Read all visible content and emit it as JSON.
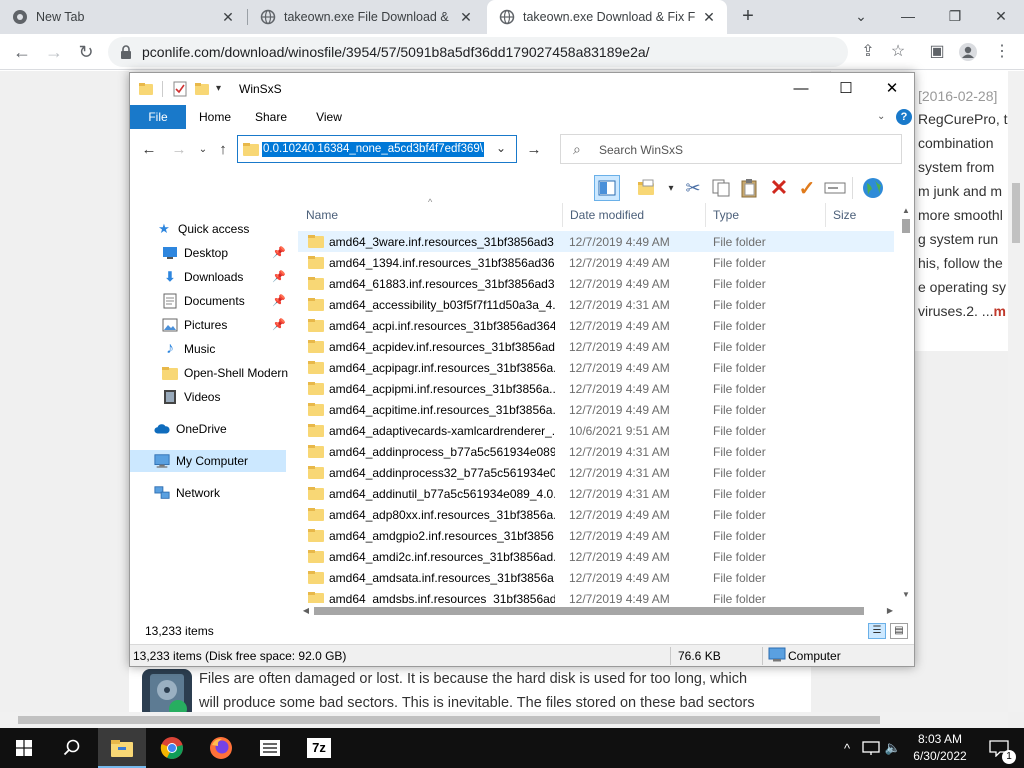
{
  "browser": {
    "tabs": [
      {
        "title": "New Tab",
        "active": false
      },
      {
        "title": "takeown.exe File Download & Fix",
        "active": false
      },
      {
        "title": "takeown.exe Download & Fix For",
        "active": true
      }
    ],
    "url": "pconlife.com/download/winosfile/3954/57/5091b8a5df36dd179027458a83189e2a/"
  },
  "webpage": {
    "side_lines": [
      "[2016-02-28]",
      "RegCurePro, t",
      "combination",
      "system from",
      "m junk and m",
      "more smoothl",
      "g system run",
      "his, follow the",
      "e operating sy",
      "viruses.2.  ..."
    ],
    "side_more": "m",
    "article_lines": [
      "Files are often damaged or lost. It is because the hard disk is used for too long, which",
      "will produce some bad sectors. This is inevitable. The files stored on these bad sectors"
    ]
  },
  "explorer": {
    "title": "WinSxS",
    "ribbon_tabs": [
      "File",
      "Home",
      "Share",
      "View"
    ],
    "address_path": "0.0.10240.16384_none_a5cd3bf4f7edf369\\",
    "search_placeholder": "Search WinSxS",
    "nav": [
      {
        "label": "Quick access",
        "icon": "star-icon",
        "indent": 0,
        "pinned": false
      },
      {
        "label": "Desktop",
        "icon": "desktop-icon",
        "indent": 1,
        "pinned": true
      },
      {
        "label": "Downloads",
        "icon": "download-icon",
        "indent": 1,
        "pinned": true
      },
      {
        "label": "Documents",
        "icon": "document-icon",
        "indent": 1,
        "pinned": true
      },
      {
        "label": "Pictures",
        "icon": "pictures-icon",
        "indent": 1,
        "pinned": true
      },
      {
        "label": "Music",
        "icon": "music-icon",
        "indent": 1,
        "pinned": false
      },
      {
        "label": "Open-Shell Modern",
        "icon": "folder-icon",
        "indent": 1,
        "pinned": false
      },
      {
        "label": "Videos",
        "icon": "video-icon",
        "indent": 1,
        "pinned": false
      },
      {
        "label": "OneDrive",
        "icon": "cloud-icon",
        "indent": 0,
        "pinned": false
      },
      {
        "label": "My Computer",
        "icon": "computer-icon",
        "indent": 0,
        "pinned": false,
        "selected": true
      },
      {
        "label": "Network",
        "icon": "network-icon",
        "indent": 0,
        "pinned": false
      }
    ],
    "columns": {
      "name": "Name",
      "date": "Date modified",
      "type": "Type",
      "size": "Size"
    },
    "files": [
      {
        "name": "amd64_3ware.inf.resources_31bf3856ad3...",
        "date": "12/7/2019 4:49 AM",
        "type": "File folder"
      },
      {
        "name": "amd64_1394.inf.resources_31bf3856ad36...",
        "date": "12/7/2019 4:49 AM",
        "type": "File folder"
      },
      {
        "name": "amd64_61883.inf.resources_31bf3856ad3...",
        "date": "12/7/2019 4:49 AM",
        "type": "File folder"
      },
      {
        "name": "amd64_accessibility_b03f5f7f11d50a3a_4....",
        "date": "12/7/2019 4:31 AM",
        "type": "File folder"
      },
      {
        "name": "amd64_acpi.inf.resources_31bf3856ad364...",
        "date": "12/7/2019 4:49 AM",
        "type": "File folder"
      },
      {
        "name": "amd64_acpidev.inf.resources_31bf3856ad...",
        "date": "12/7/2019 4:49 AM",
        "type": "File folder"
      },
      {
        "name": "amd64_acpipagr.inf.resources_31bf3856a...",
        "date": "12/7/2019 4:49 AM",
        "type": "File folder"
      },
      {
        "name": "amd64_acpipmi.inf.resources_31bf3856a...",
        "date": "12/7/2019 4:49 AM",
        "type": "File folder"
      },
      {
        "name": "amd64_acpitime.inf.resources_31bf3856a...",
        "date": "12/7/2019 4:49 AM",
        "type": "File folder"
      },
      {
        "name": "amd64_adaptivecards-xamlcardrenderer_...",
        "date": "10/6/2021 9:51 AM",
        "type": "File folder"
      },
      {
        "name": "amd64_addinprocess_b77a5c561934e089....",
        "date": "12/7/2019 4:31 AM",
        "type": "File folder"
      },
      {
        "name": "amd64_addinprocess32_b77a5c561934e0...",
        "date": "12/7/2019 4:31 AM",
        "type": "File folder"
      },
      {
        "name": "amd64_addinutil_b77a5c561934e089_4.0....",
        "date": "12/7/2019 4:31 AM",
        "type": "File folder"
      },
      {
        "name": "amd64_adp80xx.inf.resources_31bf3856a...",
        "date": "12/7/2019 4:49 AM",
        "type": "File folder"
      },
      {
        "name": "amd64_amdgpio2.inf.resources_31bf3856...",
        "date": "12/7/2019 4:49 AM",
        "type": "File folder"
      },
      {
        "name": "amd64_amdi2c.inf.resources_31bf3856ad...",
        "date": "12/7/2019 4:49 AM",
        "type": "File folder"
      },
      {
        "name": "amd64_amdsata.inf.resources_31bf3856a...",
        "date": "12/7/2019 4:49 AM",
        "type": "File folder"
      },
      {
        "name": "amd64_amdsbs.inf.resources_31bf3856ad...",
        "date": "12/7/2019 4:49 AM",
        "type": "File folder"
      }
    ],
    "item_count": "13,233 items",
    "status": {
      "items_disk": "13,233 items (Disk free space: 92.0 GB)",
      "size": "76.6 KB",
      "location": "Computer"
    }
  },
  "taskbar": {
    "apps": [
      "start-icon",
      "search-icon",
      "file-explorer-icon",
      "chrome-icon",
      "firefox-icon",
      "list-app-icon",
      "7zip-icon"
    ],
    "time": "8:03 AM",
    "date": "6/30/2022",
    "notification_count": "1",
    "seven_zip_label": "7z"
  },
  "colors": {
    "accent": "#1979ca",
    "folder": "#f8d775",
    "selection": "#cce8ff"
  }
}
